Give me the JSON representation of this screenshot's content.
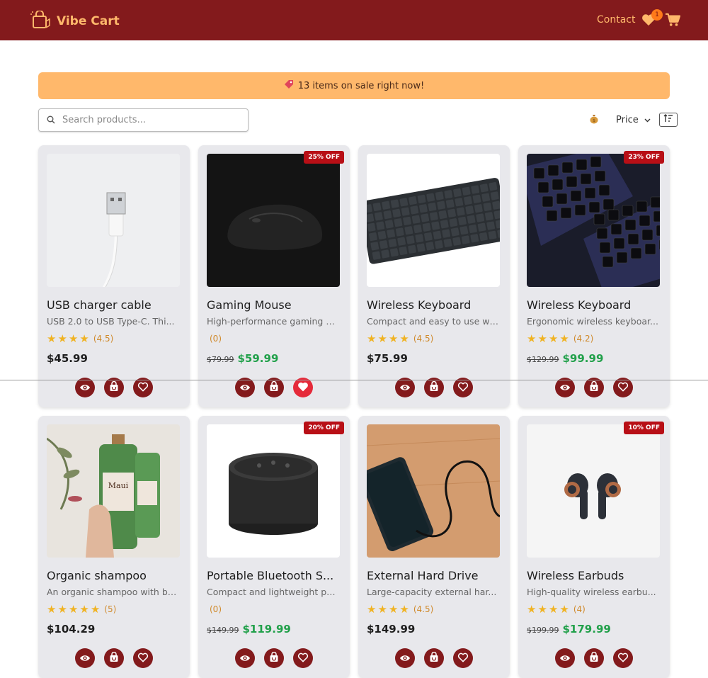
{
  "app": {
    "name": "Vibe Cart",
    "logo_icon": "shopping-bag-icon"
  },
  "header": {
    "contact_label": "Contact",
    "wishlist_count": "1"
  },
  "banner": {
    "icon": "tag-icon",
    "text": "13 items on sale right now!"
  },
  "search": {
    "placeholder": "Search products..."
  },
  "sort": {
    "icon": "money-bag-icon",
    "selected": "Price",
    "options": [
      "Price"
    ]
  },
  "colors": {
    "brand": "#831a1c",
    "accent": "#ffb86b",
    "sale_price": "#21a04a",
    "badge": "#b80f16",
    "star": "#f0b323"
  },
  "products": [
    {
      "title": "USB charger cable",
      "desc": "USB 2.0 to USB Type-C. Thi...",
      "rating_text": "(4.5)",
      "stars": 4.5,
      "price": "$45.99",
      "old_price": "",
      "badge": "",
      "liked": false,
      "image": "usb-cable"
    },
    {
      "title": "Gaming Mouse",
      "desc": "High-performance gaming m...",
      "rating_text": "(0)",
      "stars": 0,
      "price": "$59.99",
      "old_price": "$79.99",
      "badge": "25% OFF",
      "liked": true,
      "image": "gaming-mouse"
    },
    {
      "title": "Wireless Keyboard",
      "desc": "Compact and easy to use wi...",
      "rating_text": "(4.5)",
      "stars": 4.5,
      "price": "$75.99",
      "old_price": "",
      "badge": "",
      "liked": false,
      "image": "keyboard-flat"
    },
    {
      "title": "Wireless Keyboard",
      "desc": "Ergonomic wireless keyboar...",
      "rating_text": "(4.2)",
      "stars": 4.2,
      "price": "$99.99",
      "old_price": "$129.99",
      "badge": "23% OFF",
      "liked": false,
      "image": "keyboard-split"
    },
    {
      "title": "Organic shampoo",
      "desc": "An organic shampoo with ba...",
      "rating_text": "(5)",
      "stars": 5,
      "price": "$104.29",
      "old_price": "",
      "badge": "",
      "liked": false,
      "image": "shampoo"
    },
    {
      "title": "Portable Bluetooth S...",
      "desc": "Compact and lightweight po...",
      "rating_text": "(0)",
      "stars": 0,
      "price": "$119.99",
      "old_price": "$149.99",
      "badge": "20% OFF",
      "liked": false,
      "image": "speaker"
    },
    {
      "title": "External Hard Drive",
      "desc": "Large-capacity external har...",
      "rating_text": "(4.5)",
      "stars": 4.5,
      "price": "$149.99",
      "old_price": "",
      "badge": "",
      "liked": false,
      "image": "hard-drive"
    },
    {
      "title": "Wireless Earbuds",
      "desc": "High-quality wireless earbu...",
      "rating_text": "(4)",
      "stars": 4,
      "price": "$179.99",
      "old_price": "$199.99",
      "badge": "10% OFF",
      "liked": false,
      "image": "earbuds"
    }
  ]
}
